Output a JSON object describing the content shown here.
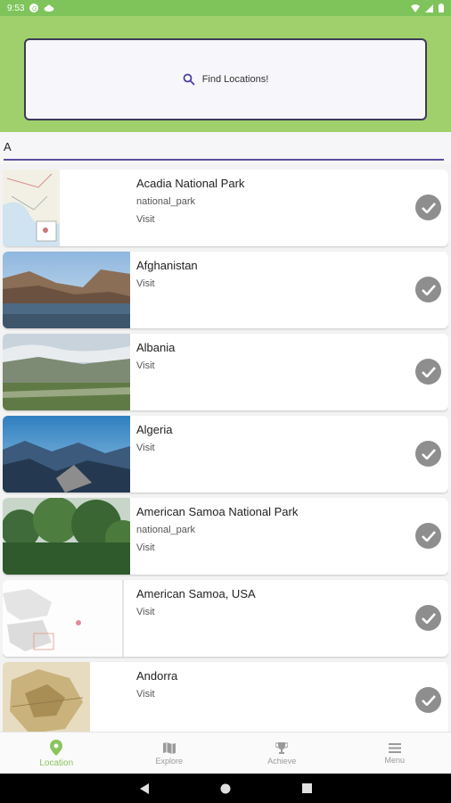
{
  "status_bar": {
    "time": "9:53"
  },
  "header": {
    "find_button_label": "Find Locations!"
  },
  "search": {
    "value": "A"
  },
  "locations": [
    {
      "title": "Acadia National Park",
      "subtitle": "national_park",
      "visit": "Visit"
    },
    {
      "title": "Afghanistan",
      "visit": "Visit"
    },
    {
      "title": "Albania",
      "visit": "Visit"
    },
    {
      "title": "Algeria",
      "visit": "Visit"
    },
    {
      "title": "American Samoa National Park",
      "subtitle": "national_park",
      "visit": "Visit"
    },
    {
      "title": "American Samoa, USA",
      "visit": "Visit"
    },
    {
      "title": "Andorra",
      "visit": "Visit"
    }
  ],
  "bottom_nav": [
    {
      "label": "Location",
      "icon": "location-pin-icon"
    },
    {
      "label": "Explore",
      "icon": "map-icon"
    },
    {
      "label": "Achieve",
      "icon": "trophy-icon"
    },
    {
      "label": "Menu",
      "icon": "menu-icon"
    }
  ],
  "colors": {
    "accent_green": "#9fd06c",
    "active_nav": "#8cc45d",
    "underline": "#5b4e9e"
  }
}
